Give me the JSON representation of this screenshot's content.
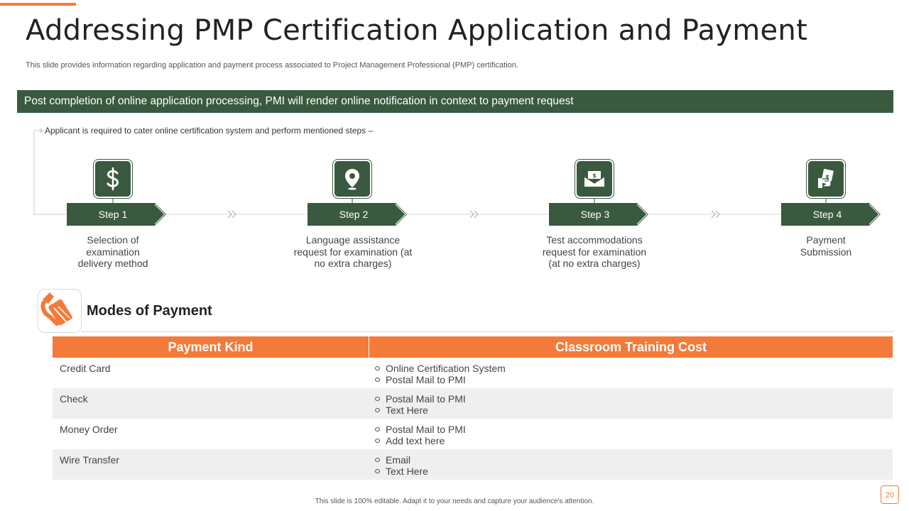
{
  "title": "Addressing PMP Certification Application and Payment",
  "subtitle": "This slide provides information regarding application and payment process associated to Project Management Professional (PMP) certification.",
  "banner": "Post completion of online application processing, PMI will render online notification in context to payment request",
  "intro": "Applicant is required  to cater online certification system and perform  mentioned steps –",
  "colors": {
    "accent": "#f47a3a",
    "primary": "#3a5a40",
    "row_alt": "#efefef"
  },
  "steps": [
    {
      "label": "Step 1",
      "icon": "dollar-icon",
      "desc": [
        "Selection of",
        "examination",
        "delivery method"
      ]
    },
    {
      "label": "Step 2",
      "icon": "location-pin-icon",
      "desc": [
        "Language assistance",
        "request for examination (at",
        "no extra charges)"
      ]
    },
    {
      "label": "Step 3",
      "icon": "money-envelope-icon",
      "desc": [
        "Test accommodations",
        "request for examination",
        "(at no extra charges)"
      ]
    },
    {
      "label": "Step 4",
      "icon": "hand-with-cash-icon",
      "desc": [
        "Payment",
        "Submission"
      ]
    }
  ],
  "modes": {
    "title": "Modes of Payment",
    "icon": "credit-card-hand-icon",
    "headers": [
      "Payment Kind",
      "Classroom Training Cost"
    ],
    "rows": [
      {
        "kind": "Credit Card",
        "items": [
          "Online Certification System",
          "Postal Mail to PMI"
        ]
      },
      {
        "kind": "Check",
        "items": [
          "Postal Mail to PMI",
          "Text Here"
        ]
      },
      {
        "kind": "Money Order",
        "items": [
          "Postal Mail to PMI",
          "Add text here"
        ]
      },
      {
        "kind": "Wire Transfer",
        "items": [
          "Email",
          "Text Here"
        ]
      }
    ]
  },
  "footer": "This slide is 100% editable. Adapt it to your needs and capture your audience's attention.",
  "page_number": "20"
}
